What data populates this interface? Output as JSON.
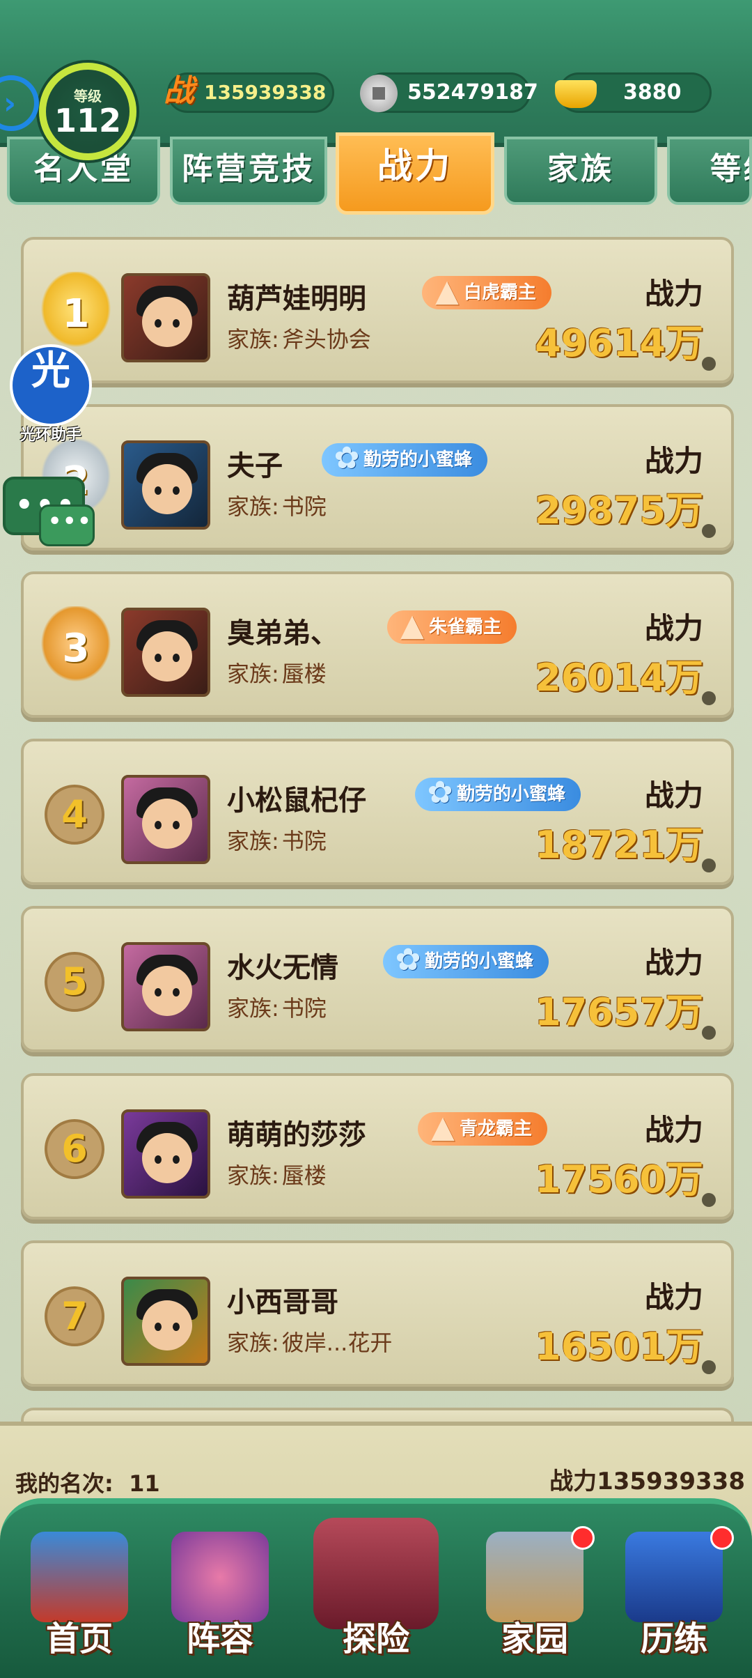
{
  "header": {
    "level_label": "等级",
    "level": "112",
    "power_icon": "战",
    "power": "135939338",
    "silver": "552479187",
    "gold": "3880"
  },
  "tabs": [
    {
      "label": "名人堂",
      "active": false
    },
    {
      "label": "阵营竞技",
      "active": false
    },
    {
      "label": "战力",
      "active": true
    },
    {
      "label": "家族",
      "active": false
    },
    {
      "label": "等级",
      "active": false
    }
  ],
  "rankings": [
    {
      "rank": "1",
      "name": "葫芦娃明明",
      "badge": "白虎霸主",
      "badge_color": "orange",
      "family_label": "家族:",
      "family": "斧头协会",
      "power_label": "战力",
      "power": "49614万"
    },
    {
      "rank": "2",
      "name": "夫子",
      "badge": "勤劳的小蜜蜂",
      "badge_color": "blue",
      "family_label": "家族:",
      "family": "书院",
      "power_label": "战力",
      "power": "29875万"
    },
    {
      "rank": "3",
      "name": "臭弟弟、",
      "badge": "朱雀霸主",
      "badge_color": "orange",
      "family_label": "家族:",
      "family": "蜃楼",
      "power_label": "战力",
      "power": "26014万"
    },
    {
      "rank": "4",
      "name": "小松鼠杞仔",
      "badge": "勤劳的小蜜蜂",
      "badge_color": "blue",
      "family_label": "家族:",
      "family": "书院",
      "power_label": "战力",
      "power": "18721万"
    },
    {
      "rank": "5",
      "name": "水火无情",
      "badge": "勤劳的小蜜蜂",
      "badge_color": "blue",
      "family_label": "家族:",
      "family": "书院",
      "power_label": "战力",
      "power": "17657万"
    },
    {
      "rank": "6",
      "name": "萌萌的莎莎",
      "badge": "青龙霸主",
      "badge_color": "orange",
      "family_label": "家族:",
      "family": "蜃楼",
      "power_label": "战力",
      "power": "17560万"
    },
    {
      "rank": "7",
      "name": "小西哥哥",
      "badge": "",
      "badge_color": "",
      "family_label": "家族:",
      "family": "彼岸...花开",
      "power_label": "战力",
      "power": "16501万"
    }
  ],
  "helper": {
    "icon_char": "光",
    "label": "光环助手"
  },
  "chat": {
    "dots": "•••"
  },
  "my_rank": {
    "label": "我的名次:",
    "value": "11",
    "power_label": "战力",
    "power": "135939338"
  },
  "nav": [
    {
      "label": "首页",
      "icon": "home-palace-icon",
      "dot": false
    },
    {
      "label": "阵容",
      "icon": "gourd-team-icon",
      "dot": false
    },
    {
      "label": "探险",
      "icon": "explore-gate-icon",
      "dot": false
    },
    {
      "label": "家园",
      "icon": "homestead-house-icon",
      "dot": true
    },
    {
      "label": "历练",
      "icon": "training-mountain-icon",
      "dot": true
    }
  ]
}
